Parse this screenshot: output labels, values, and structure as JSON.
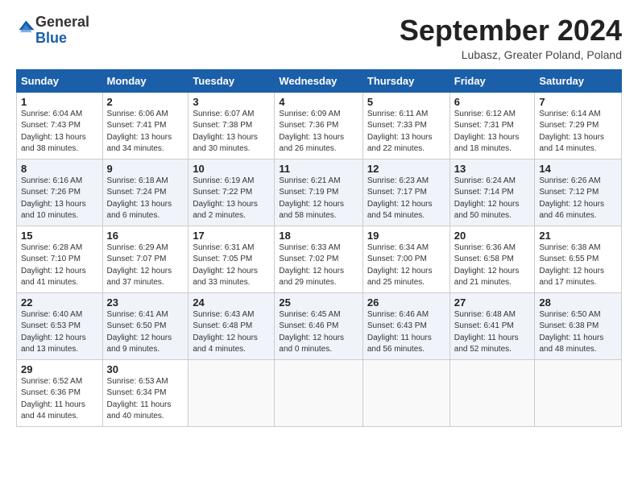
{
  "header": {
    "logo_general": "General",
    "logo_blue": "Blue",
    "month_title": "September 2024",
    "location": "Lubasz, Greater Poland, Poland"
  },
  "weekdays": [
    "Sunday",
    "Monday",
    "Tuesday",
    "Wednesday",
    "Thursday",
    "Friday",
    "Saturday"
  ],
  "weeks": [
    [
      {
        "day": "1",
        "info": "Sunrise: 6:04 AM\nSunset: 7:43 PM\nDaylight: 13 hours\nand 38 minutes."
      },
      {
        "day": "2",
        "info": "Sunrise: 6:06 AM\nSunset: 7:41 PM\nDaylight: 13 hours\nand 34 minutes."
      },
      {
        "day": "3",
        "info": "Sunrise: 6:07 AM\nSunset: 7:38 PM\nDaylight: 13 hours\nand 30 minutes."
      },
      {
        "day": "4",
        "info": "Sunrise: 6:09 AM\nSunset: 7:36 PM\nDaylight: 13 hours\nand 26 minutes."
      },
      {
        "day": "5",
        "info": "Sunrise: 6:11 AM\nSunset: 7:33 PM\nDaylight: 13 hours\nand 22 minutes."
      },
      {
        "day": "6",
        "info": "Sunrise: 6:12 AM\nSunset: 7:31 PM\nDaylight: 13 hours\nand 18 minutes."
      },
      {
        "day": "7",
        "info": "Sunrise: 6:14 AM\nSunset: 7:29 PM\nDaylight: 13 hours\nand 14 minutes."
      }
    ],
    [
      {
        "day": "8",
        "info": "Sunrise: 6:16 AM\nSunset: 7:26 PM\nDaylight: 13 hours\nand 10 minutes."
      },
      {
        "day": "9",
        "info": "Sunrise: 6:18 AM\nSunset: 7:24 PM\nDaylight: 13 hours\nand 6 minutes."
      },
      {
        "day": "10",
        "info": "Sunrise: 6:19 AM\nSunset: 7:22 PM\nDaylight: 13 hours\nand 2 minutes."
      },
      {
        "day": "11",
        "info": "Sunrise: 6:21 AM\nSunset: 7:19 PM\nDaylight: 12 hours\nand 58 minutes."
      },
      {
        "day": "12",
        "info": "Sunrise: 6:23 AM\nSunset: 7:17 PM\nDaylight: 12 hours\nand 54 minutes."
      },
      {
        "day": "13",
        "info": "Sunrise: 6:24 AM\nSunset: 7:14 PM\nDaylight: 12 hours\nand 50 minutes."
      },
      {
        "day": "14",
        "info": "Sunrise: 6:26 AM\nSunset: 7:12 PM\nDaylight: 12 hours\nand 46 minutes."
      }
    ],
    [
      {
        "day": "15",
        "info": "Sunrise: 6:28 AM\nSunset: 7:10 PM\nDaylight: 12 hours\nand 41 minutes."
      },
      {
        "day": "16",
        "info": "Sunrise: 6:29 AM\nSunset: 7:07 PM\nDaylight: 12 hours\nand 37 minutes."
      },
      {
        "day": "17",
        "info": "Sunrise: 6:31 AM\nSunset: 7:05 PM\nDaylight: 12 hours\nand 33 minutes."
      },
      {
        "day": "18",
        "info": "Sunrise: 6:33 AM\nSunset: 7:02 PM\nDaylight: 12 hours\nand 29 minutes."
      },
      {
        "day": "19",
        "info": "Sunrise: 6:34 AM\nSunset: 7:00 PM\nDaylight: 12 hours\nand 25 minutes."
      },
      {
        "day": "20",
        "info": "Sunrise: 6:36 AM\nSunset: 6:58 PM\nDaylight: 12 hours\nand 21 minutes."
      },
      {
        "day": "21",
        "info": "Sunrise: 6:38 AM\nSunset: 6:55 PM\nDaylight: 12 hours\nand 17 minutes."
      }
    ],
    [
      {
        "day": "22",
        "info": "Sunrise: 6:40 AM\nSunset: 6:53 PM\nDaylight: 12 hours\nand 13 minutes."
      },
      {
        "day": "23",
        "info": "Sunrise: 6:41 AM\nSunset: 6:50 PM\nDaylight: 12 hours\nand 9 minutes."
      },
      {
        "day": "24",
        "info": "Sunrise: 6:43 AM\nSunset: 6:48 PM\nDaylight: 12 hours\nand 4 minutes."
      },
      {
        "day": "25",
        "info": "Sunrise: 6:45 AM\nSunset: 6:46 PM\nDaylight: 12 hours\nand 0 minutes."
      },
      {
        "day": "26",
        "info": "Sunrise: 6:46 AM\nSunset: 6:43 PM\nDaylight: 11 hours\nand 56 minutes."
      },
      {
        "day": "27",
        "info": "Sunrise: 6:48 AM\nSunset: 6:41 PM\nDaylight: 11 hours\nand 52 minutes."
      },
      {
        "day": "28",
        "info": "Sunrise: 6:50 AM\nSunset: 6:38 PM\nDaylight: 11 hours\nand 48 minutes."
      }
    ],
    [
      {
        "day": "29",
        "info": "Sunrise: 6:52 AM\nSunset: 6:36 PM\nDaylight: 11 hours\nand 44 minutes."
      },
      {
        "day": "30",
        "info": "Sunrise: 6:53 AM\nSunset: 6:34 PM\nDaylight: 11 hours\nand 40 minutes."
      },
      {
        "day": "",
        "info": ""
      },
      {
        "day": "",
        "info": ""
      },
      {
        "day": "",
        "info": ""
      },
      {
        "day": "",
        "info": ""
      },
      {
        "day": "",
        "info": ""
      }
    ]
  ]
}
